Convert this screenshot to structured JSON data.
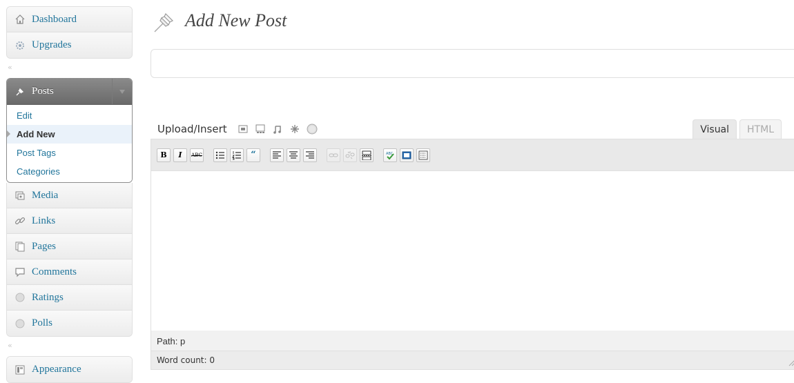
{
  "sidebar": {
    "top_items": [
      {
        "label": "Dashboard",
        "icon": "house-icon"
      },
      {
        "label": "Upgrades",
        "icon": "gear-icon"
      }
    ],
    "collapse_arrow": "«",
    "posts": {
      "label": "Posts",
      "icon": "pushpin-icon",
      "submenu": [
        {
          "label": "Edit",
          "current": false
        },
        {
          "label": "Add New",
          "current": true
        },
        {
          "label": "Post Tags",
          "current": false
        },
        {
          "label": "Categories",
          "current": false
        }
      ]
    },
    "content_items": [
      {
        "label": "Media",
        "icon": "media-icon"
      },
      {
        "label": "Links",
        "icon": "link-icon"
      },
      {
        "label": "Pages",
        "icon": "pages-icon"
      },
      {
        "label": "Comments",
        "icon": "comment-icon"
      },
      {
        "label": "Ratings",
        "icon": "circle-icon"
      },
      {
        "label": "Polls",
        "icon": "circle-icon"
      }
    ],
    "appearance": {
      "label": "Appearance",
      "icon": "appearance-icon"
    }
  },
  "main": {
    "page_title": "Add New Post",
    "title_input": {
      "value": "",
      "placeholder": ""
    },
    "upload_label": "Upload/Insert",
    "media_buttons": [
      "image-icon",
      "gallery-icon",
      "music-icon",
      "sparkle-icon",
      "circle-icon"
    ],
    "tabs": {
      "visual": "Visual",
      "html": "HTML"
    },
    "toolbar": {
      "bold": "B",
      "italic": "I",
      "strike": "ABC"
    },
    "path_label": "Path: p",
    "word_count": "Word count: 0"
  },
  "colors": {
    "link": "#21759b",
    "posts_header": "#6f6f6f",
    "current_bg": "#eaf2fa"
  }
}
